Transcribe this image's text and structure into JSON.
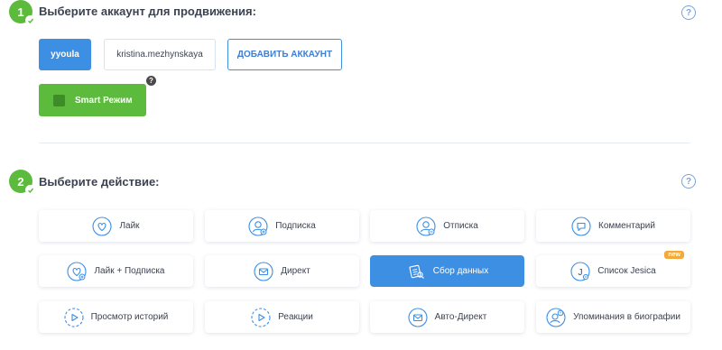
{
  "step1": {
    "number": "1",
    "title": "Выберите аккаунт для продвижения:"
  },
  "accounts": [
    "yyoula",
    "kristina.mezhynskaya"
  ],
  "add_account_label": "ДОБАВИТЬ АККАУНТ",
  "smart_mode": {
    "label": "Smart Режим",
    "help": "?"
  },
  "help": "?",
  "step2": {
    "number": "2",
    "title": "Выберите действие:"
  },
  "actions": [
    {
      "label": "Лайк",
      "icon": "heart-icon"
    },
    {
      "label": "Подписка",
      "icon": "user-plus-icon"
    },
    {
      "label": "Отписка",
      "icon": "user-minus-icon"
    },
    {
      "label": "Комментарий",
      "icon": "comment-icon"
    },
    {
      "label": "Лайк + Подписка",
      "icon": "heart-plus-icon"
    },
    {
      "label": "Директ",
      "icon": "mail-icon"
    },
    {
      "label": "Сбор данных",
      "icon": "data-collect-icon"
    },
    {
      "label": "Список Jesica",
      "icon": "jesica-icon",
      "badge": "new"
    },
    {
      "label": "Просмотр историй",
      "icon": "story-play-icon"
    },
    {
      "label": "Реакции",
      "icon": "reaction-play-icon"
    },
    {
      "label": "Авто-Директ",
      "icon": "auto-mail-icon"
    },
    {
      "label": "Упоминания в биографии",
      "icon": "mention-user-icon"
    }
  ],
  "colors": {
    "primary": "#3d8fe3",
    "success": "#5cba3c",
    "badge": "#f4a93a"
  }
}
